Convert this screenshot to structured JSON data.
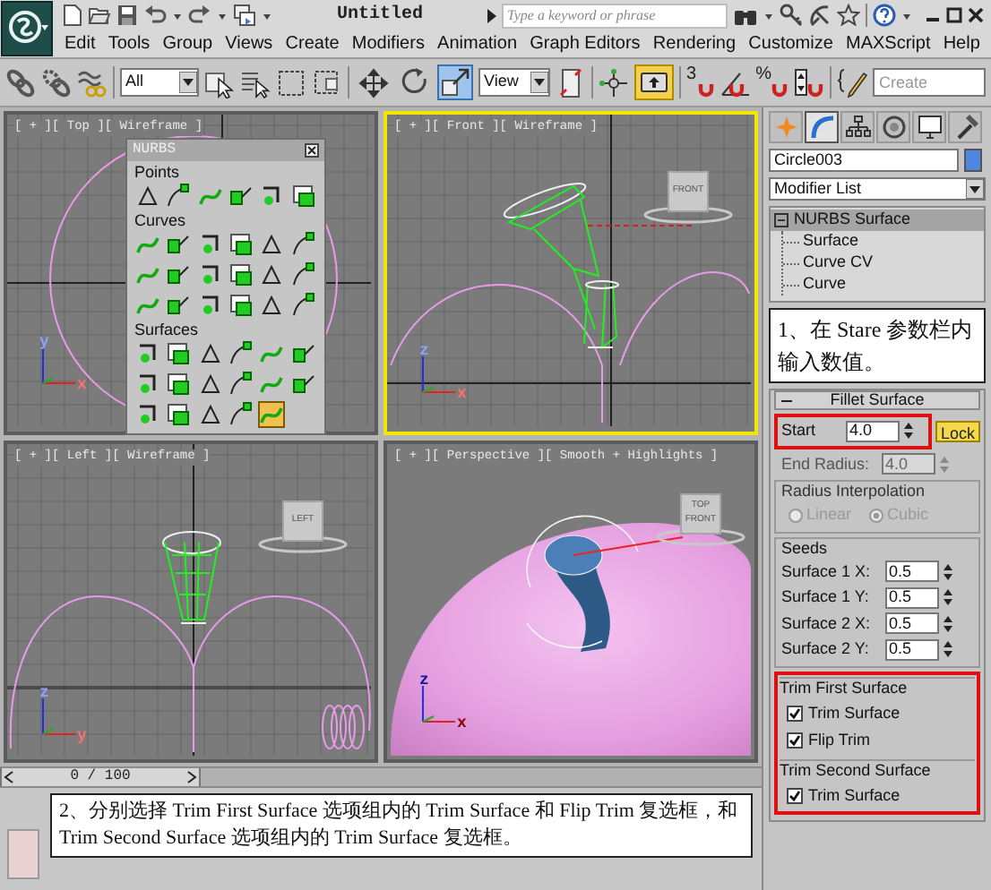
{
  "title_bar": {
    "title": "Untitled",
    "search": {
      "placeholder": "Type a keyword or phrase"
    }
  },
  "menu": [
    "Edit",
    "Tools",
    "Group",
    "Views",
    "Create",
    "Modifiers",
    "Animation",
    "Graph Editors",
    "Rendering",
    "Customize",
    "MAXScript",
    "Help"
  ],
  "toolbar": {
    "selection_filter": "All",
    "transform_tools": [
      {
        "selected": false
      },
      {
        "selected": false
      },
      {
        "selected": true
      }
    ],
    "reference_coordinate_system": "View",
    "keyboard_shortcut_override": {
      "on": true
    },
    "snap_labels": [
      "3",
      "%"
    ],
    "named_selection": {
      "placeholder": "Create"
    }
  },
  "viewports": [
    {
      "kind": "top",
      "label": "[ + ][ Top ][ Wireframe ]",
      "active": false,
      "axis_labels": [
        "y",
        "x"
      ]
    },
    {
      "kind": "front",
      "label": "[ + ][ Front ][ Wireframe ]",
      "active": true,
      "axis_labels": [
        "z",
        "x"
      ],
      "cube_labels": [
        "FRONT"
      ]
    },
    {
      "kind": "left",
      "label": "[ + ][ Left ][ Wireframe ]",
      "active": false,
      "axis_labels": [
        "z",
        "y"
      ],
      "cube_labels": [
        "LEFT"
      ]
    },
    {
      "kind": "perspective",
      "label": "[ + ][ Perspective ][ Smooth + Highlights ]",
      "active": false,
      "axis_labels": [
        "z",
        "x"
      ],
      "cube_labels": [
        "TOP",
        "FRONT"
      ]
    }
  ],
  "nurbs_panel": {
    "title": "NURBS",
    "sections": [
      {
        "label": "Points",
        "tools": [
          {
            "selected": false
          },
          {
            "selected": false
          },
          {
            "selected": false
          },
          {
            "selected": false
          },
          {
            "selected": false
          },
          {
            "selected": false
          }
        ]
      },
      {
        "label": "Curves",
        "tools": [
          {
            "selected": false
          },
          {
            "selected": false
          },
          {
            "selected": false
          },
          {
            "selected": false
          },
          {
            "selected": false
          },
          {
            "selected": false
          },
          {
            "selected": false
          },
          {
            "selected": false
          },
          {
            "selected": false
          },
          {
            "selected": false
          },
          {
            "selected": false
          },
          {
            "selected": false
          },
          {
            "selected": false
          },
          {
            "selected": false
          },
          {
            "selected": false
          },
          {
            "selected": false
          },
          {
            "selected": false
          },
          {
            "selected": false
          }
        ]
      },
      {
        "label": "Surfaces",
        "tools": [
          {
            "selected": false
          },
          {
            "selected": false
          },
          {
            "selected": false
          },
          {
            "selected": false
          },
          {
            "selected": false
          },
          {
            "selected": false
          },
          {
            "selected": false
          },
          {
            "selected": false
          },
          {
            "selected": false
          },
          {
            "selected": false
          },
          {
            "selected": false
          },
          {
            "selected": false
          },
          {
            "selected": false
          },
          {
            "selected": false
          },
          {
            "selected": false
          },
          {
            "selected": false
          },
          {
            "selected": true
          }
        ]
      }
    ]
  },
  "time_slider": {
    "label": "0 / 100",
    "level": 0
  },
  "command_panel": {
    "tabs": [
      {
        "selected": false
      },
      {
        "selected": true
      },
      {
        "selected": false
      },
      {
        "selected": false
      },
      {
        "selected": false
      },
      {
        "selected": false
      }
    ],
    "object_name": "Circle003",
    "modifier_list": "Modifier List",
    "stack": [
      {
        "label": "NURBS Surface",
        "selected": true,
        "expanded": true,
        "children": [
          {
            "label": "Surface",
            "selected": false
          },
          {
            "label": "Curve CV",
            "selected": false
          },
          {
            "label": "Curve",
            "selected": false
          }
        ]
      }
    ],
    "rollout": {
      "title": "Fillet Surface",
      "expanded": true,
      "start": {
        "label": "Start",
        "value": "4.0",
        "highlighted": true
      },
      "lock": {
        "label": "Lock",
        "on": true
      },
      "end_radius": {
        "label": "End Radius:",
        "value": "4.0",
        "disabled": true
      },
      "radius_interpolation": {
        "label": "Radius Interpolation",
        "disabled": true,
        "options": [
          {
            "label": "Linear",
            "selected": false
          },
          {
            "label": "Cubic",
            "selected": true
          }
        ]
      },
      "seeds": {
        "label": "Seeds",
        "fields": [
          {
            "label": "Surface 1 X:",
            "value": "0.5"
          },
          {
            "label": "Surface 1 Y:",
            "value": "0.5"
          },
          {
            "label": "Surface 2 X:",
            "value": "0.5"
          },
          {
            "label": "Surface 2 Y:",
            "value": "0.5"
          }
        ]
      },
      "trim_groups": {
        "highlighted": true,
        "groups": [
          {
            "label": "Trim First Surface",
            "options": [
              {
                "label": "Trim Surface",
                "checked": true
              },
              {
                "label": "Flip Trim",
                "checked": true
              }
            ]
          },
          {
            "label": "Trim Second Surface",
            "options": [
              {
                "label": "Trim Surface",
                "checked": true
              }
            ]
          }
        ]
      }
    }
  },
  "annotations": [
    {
      "text": "1、在 Stare 参数栏内输入数值。"
    },
    {
      "text": "2、分别选择 Trim First Surface 选项组内的 Trim Surface 和 Flip Trim 复选框，和 Trim Second Surface 选项组内的 Trim Surface 复选框。"
    }
  ]
}
